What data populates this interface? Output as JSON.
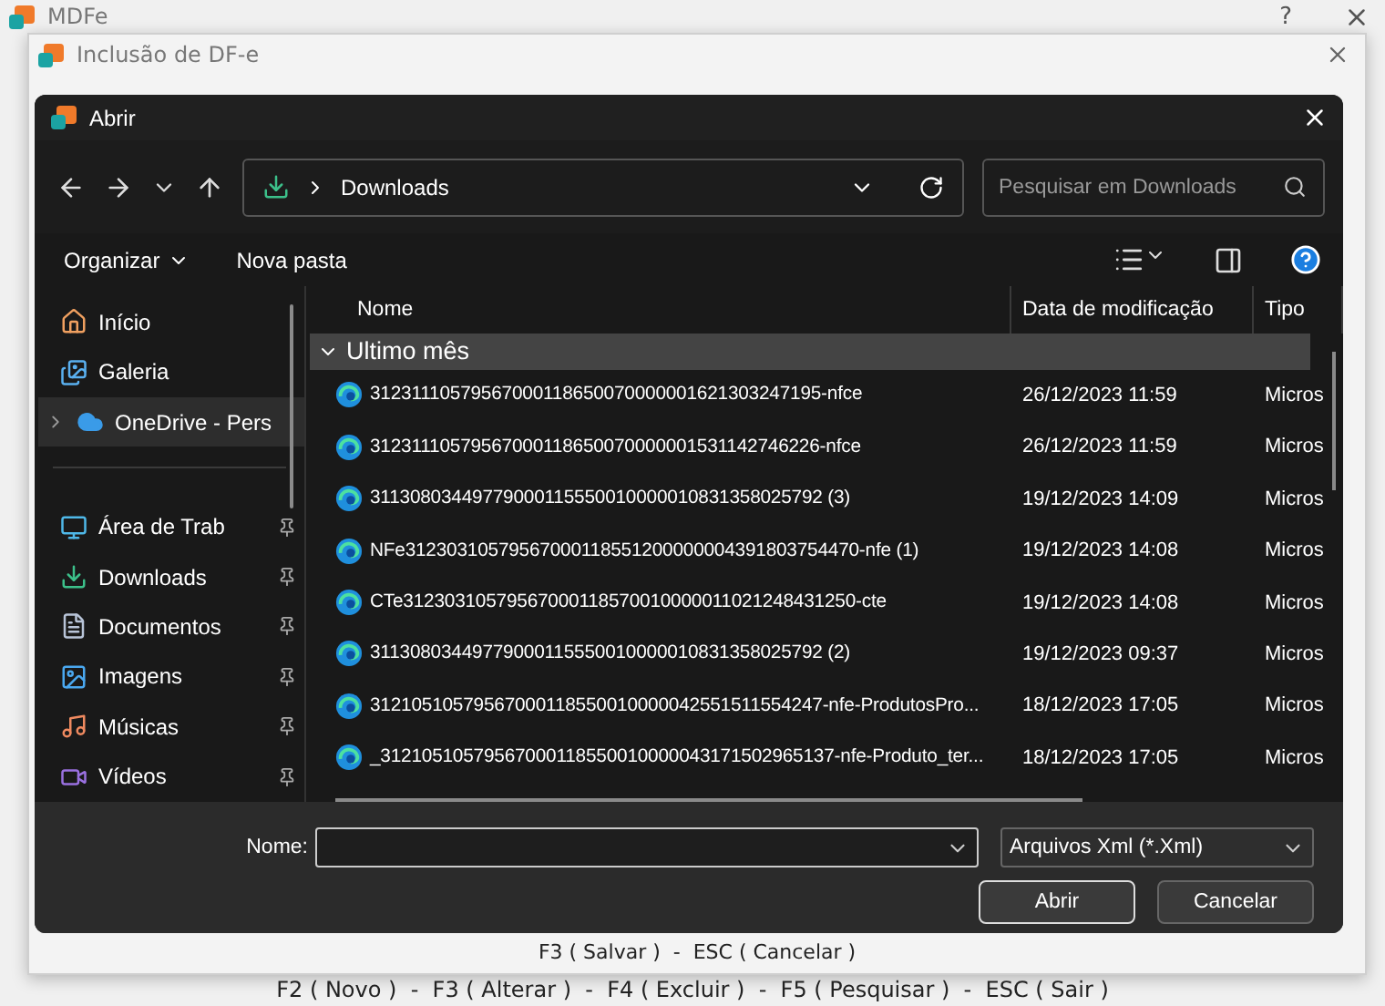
{
  "app_window": {
    "title": "MDFe",
    "help": "?"
  },
  "form_window": {
    "title": "Inclusão de DF-e",
    "footer": "F3 ( Salvar )  -  ESC ( Cancelar )"
  },
  "dialog": {
    "title": "Abrir",
    "address": "Downloads",
    "search": {
      "placeholder": "Pesquisar em Downloads"
    },
    "toolbar": [
      "Organizar",
      "Nova pasta"
    ],
    "sidebar": {
      "locations": [
        {
          "label": "Início",
          "kind": "home",
          "selected": false
        },
        {
          "label": "Galeria",
          "kind": "gallery",
          "selected": false
        },
        {
          "label": "OneDrive - Pers",
          "kind": "cloud",
          "selected": true
        }
      ],
      "quick_access": [
        {
          "label": "Área de Trab",
          "kind": "desktop",
          "pinned": true
        },
        {
          "label": "Downloads",
          "kind": "download",
          "pinned": true
        },
        {
          "label": "Documentos",
          "kind": "document",
          "pinned": true
        },
        {
          "label": "Imagens",
          "kind": "image",
          "pinned": true
        },
        {
          "label": "Músicas",
          "kind": "music",
          "pinned": true
        },
        {
          "label": "Vídeos",
          "kind": "video",
          "pinned": true
        }
      ]
    },
    "columns": [
      "Nome",
      "Data de modificação",
      "Tipo"
    ],
    "group": "Ultimo mês",
    "files": [
      {
        "name": "31231110579567000118650070000001621303247195-nfce",
        "date": "26/12/2023 11:59",
        "type": "Micros"
      },
      {
        "name": "31231110579567000118650070000001531142746226-nfce",
        "date": "26/12/2023 11:59",
        "type": "Micros"
      },
      {
        "name": "31130803449779000115550010000010831358025792 (3)",
        "date": "19/12/2023 14:09",
        "type": "Micros"
      },
      {
        "name": "NFe31230310579567000118551200000004391803754470-nfe (1)",
        "date": "19/12/2023 14:08",
        "type": "Micros"
      },
      {
        "name": "CTe31230310579567000118570010000011021248431250-cte",
        "date": "19/12/2023 14:08",
        "type": "Micros"
      },
      {
        "name": "31130803449779000115550010000010831358025792 (2)",
        "date": "19/12/2023 09:37",
        "type": "Micros"
      },
      {
        "name": "31210510579567000118550010000042551511554247-nfe-ProdutosPro...",
        "date": "18/12/2023 17:05",
        "type": "Micros"
      },
      {
        "name": "_31210510579567000118550010000043171502965137-nfe-Produto_ter...",
        "date": "18/12/2023 17:05",
        "type": "Micros"
      }
    ],
    "filename_label": "Nome:",
    "filter": "Arquivos Xml (*.Xml)",
    "buttons": [
      {
        "label": "Abrir",
        "kind": "primary"
      },
      {
        "label": "Cancelar",
        "kind": "secondary"
      }
    ]
  },
  "app_footer": "F2 ( Novo )  -  F3 ( Alterar )  -  F4 ( Excluir )  -  F5 ( Pesquisar )  -  ESC ( Sair )"
}
